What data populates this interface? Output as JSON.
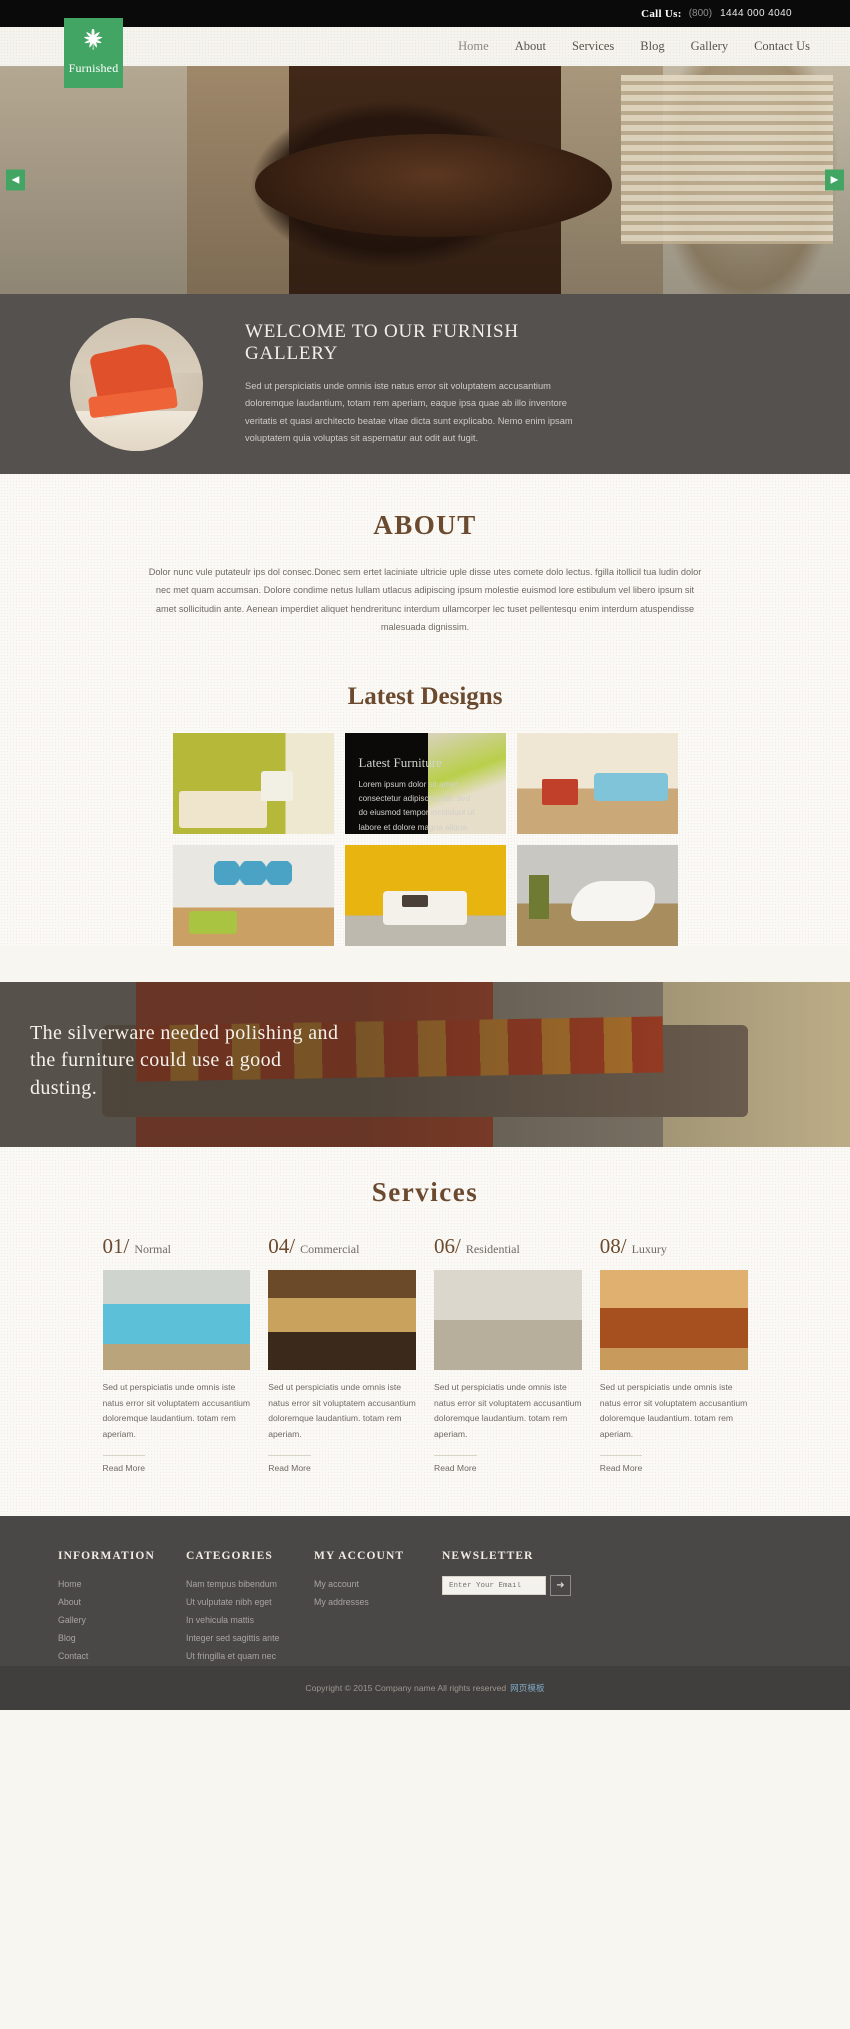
{
  "topbar": {
    "call_label": "Call Us:",
    "area_code": "(800)",
    "phone": "1444 000 4040"
  },
  "brand": {
    "name": "Furnished",
    "icon": "leaf-icon",
    "color": "#43a564"
  },
  "nav": [
    {
      "label": "Home",
      "active": true
    },
    {
      "label": "About",
      "active": false
    },
    {
      "label": "Services",
      "active": false
    },
    {
      "label": "Blog",
      "active": false
    },
    {
      "label": "Gallery",
      "active": false
    },
    {
      "label": "Contact Us",
      "active": false
    }
  ],
  "hero": {
    "prev_icon": "chevron-left-icon",
    "next_icon": "chevron-right-icon"
  },
  "welcome": {
    "title": "Welcome to our furnish gallery",
    "paragraph": "Sed ut perspiciatis unde omnis iste natus error sit voluptatem accusantium doloremque laudantium, totam rem aperiam, eaque ipsa quae ab illo inventore veritatis et quasi architecto beatae vitae dicta sunt explicabo. Nemo enim ipsam voluptatem quia voluptas sit aspernatur aut odit aut fugit."
  },
  "about": {
    "title": "ABOUT",
    "paragraph": "Dolor nunc vule putateulr ips dol consec.Donec sem ertet laciniate ultricie uple disse utes comete dolo lectus. fgilla itollicil tua ludin dolor nec met quam accumsan. Dolore condime netus Iullam utlacus adipiscing ipsum molestie euismod lore estibulum vel libero ipsum sit amet sollicitudin ante. Aenean imperdiet aliquet hendreritunc interdum ullamcorper lec tuset pellentesqu enim interdum atuspendisse malesuada dignissim."
  },
  "latest_designs": {
    "title": "Latest Designs",
    "overlay": {
      "heading": "Latest Furniture",
      "text": "Lorem ipsum dolor sit amet, consectetur adipiscing elit, sed do eiusmod tempor incididunt ut labore et dolore magna aliqua. Ut enim ad minim veniam, quis nost."
    },
    "tiles": [
      {
        "name": "design-tile-1"
      },
      {
        "name": "design-tile-2-overlay"
      },
      {
        "name": "design-tile-3"
      },
      {
        "name": "design-tile-4"
      },
      {
        "name": "design-tile-5"
      },
      {
        "name": "design-tile-6"
      }
    ]
  },
  "parallax": {
    "quote": "The silverware needed polishing and the furniture could use a good dusting."
  },
  "services": {
    "title": "Services",
    "items": [
      {
        "num": "01/",
        "name": "Normal",
        "text": "Sed ut perspiciatis unde omnis iste natus error sit voluptatem accusantium doloremque laudantium. totam rem aperiam.",
        "more": "Read More"
      },
      {
        "num": "04/",
        "name": "Commercial",
        "text": "Sed ut perspiciatis unde omnis iste natus error sit voluptatem accusantium doloremque laudantium. totam rem aperiam.",
        "more": "Read More"
      },
      {
        "num": "06/",
        "name": "Residential",
        "text": "Sed ut perspiciatis unde omnis iste natus error sit voluptatem accusantium doloremque laudantium. totam rem aperiam.",
        "more": "Read More"
      },
      {
        "num": "08/",
        "name": "Luxury",
        "text": "Sed ut perspiciatis unde omnis iste natus error sit voluptatem accusantium doloremque laudantium. totam rem aperiam.",
        "more": "Read More"
      }
    ]
  },
  "footer": {
    "information": {
      "heading": "Information",
      "links": [
        "Home",
        "About",
        "Gallery",
        "Blog",
        "Contact"
      ]
    },
    "categories": {
      "heading": "Categories",
      "links": [
        "Nam tempus bibendum",
        "Ut vulputate nibh eget",
        "In vehicula mattis",
        "Integer sed sagittis ante",
        "Ut fringilla et quam nec"
      ]
    },
    "my_account": {
      "heading": "My Account",
      "links": [
        "My account",
        "My addresses"
      ]
    },
    "newsletter": {
      "heading": "Newsletter",
      "placeholder": "Enter Your Email",
      "value": "",
      "submit_icon": "arrow-right-icon"
    },
    "copyright": "Copyright © 2015 Company name All rights reserved",
    "credit": "网页模板"
  }
}
